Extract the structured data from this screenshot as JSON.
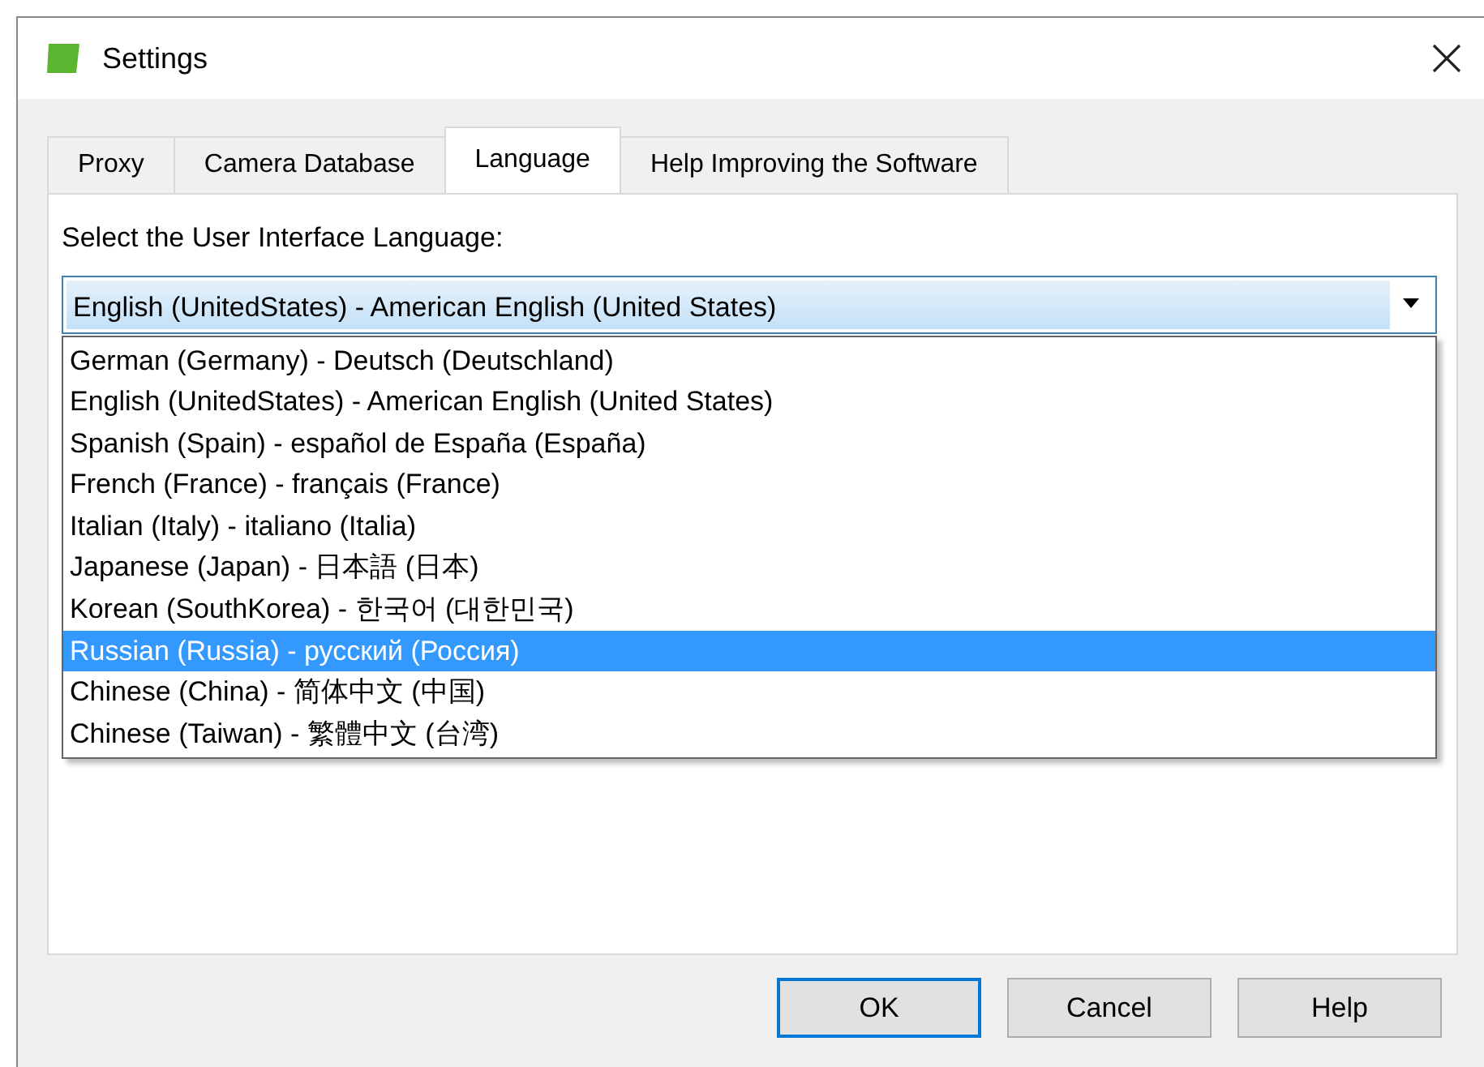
{
  "window": {
    "title": "Settings"
  },
  "tabs": [
    {
      "label": "Proxy",
      "selected": false
    },
    {
      "label": "Camera Database",
      "selected": false
    },
    {
      "label": "Language",
      "selected": true
    },
    {
      "label": "Help Improving the Software",
      "selected": false
    }
  ],
  "language_label": "Select the User Interface Language:",
  "language_combo": {
    "value": "English (UnitedStates) - American English (United States)",
    "expanded": true
  },
  "language_options": [
    {
      "label": "German (Germany) - Deutsch (Deutschland)",
      "selected": false
    },
    {
      "label": "English (UnitedStates) - American English (United States)",
      "selected": false
    },
    {
      "label": "Spanish (Spain) - español de España (España)",
      "selected": false
    },
    {
      "label": "French (France) - français (France)",
      "selected": false
    },
    {
      "label": "Italian (Italy) - italiano (Italia)",
      "selected": false
    },
    {
      "label": "Japanese (Japan) - 日本語 (日本)",
      "selected": false
    },
    {
      "label": "Korean (SouthKorea) - 한국어 (대한민국)",
      "selected": false
    },
    {
      "label": "Russian (Russia) - русский (Россия)",
      "selected": true
    },
    {
      "label": "Chinese (China) - 简体中文 (中国)",
      "selected": false
    },
    {
      "label": "Chinese (Taiwan) - 繁體中文 (台湾)",
      "selected": false
    }
  ],
  "buttons": [
    {
      "label": "OK",
      "default": true
    },
    {
      "label": "Cancel",
      "default": false
    },
    {
      "label": "Help",
      "default": false
    }
  ]
}
